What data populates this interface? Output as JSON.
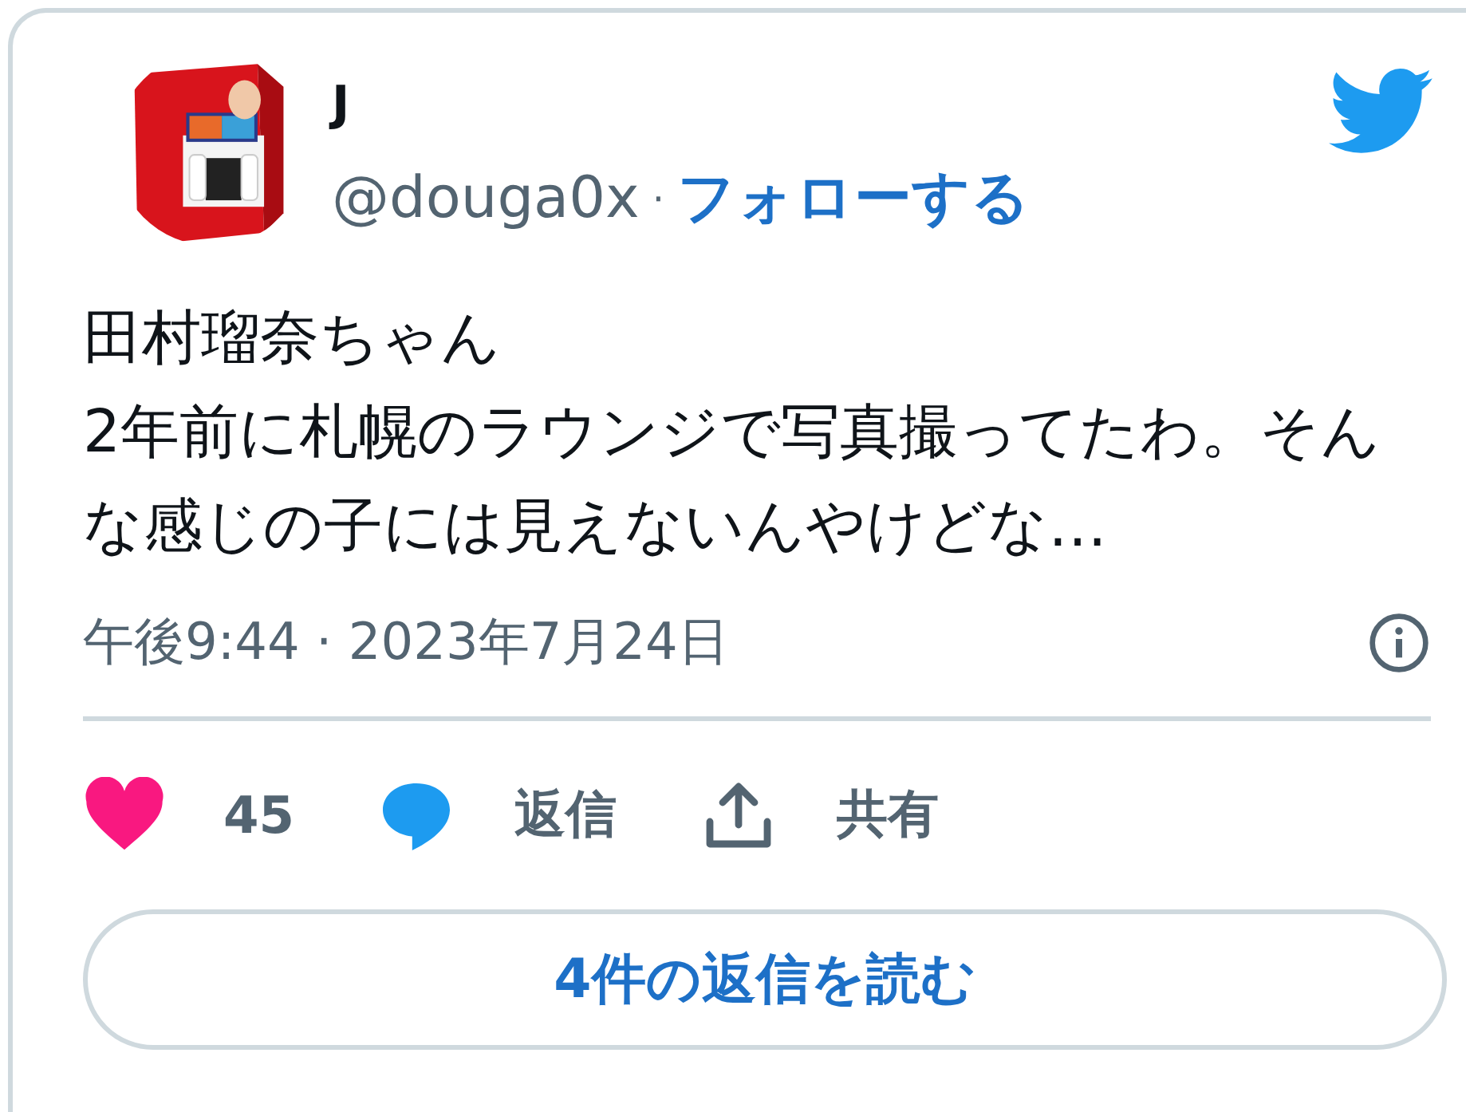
{
  "author": {
    "name": "J",
    "handle": "@douga0x",
    "separator": "·",
    "follow": "フォローする"
  },
  "text": "田村瑠奈ちゃん\n2年前に札幌のラウンジで写真撮ってたわ。そんな感じの子には見えないんやけどな…",
  "timestamp": "午後9:44 · 2023年7月24日",
  "actions": [
    {
      "kind": "like",
      "label": "45",
      "selected": true
    },
    {
      "kind": "reply",
      "label": "返信"
    },
    {
      "kind": "share",
      "label": "共有"
    }
  ],
  "read_replies": "4件の返信を読む"
}
